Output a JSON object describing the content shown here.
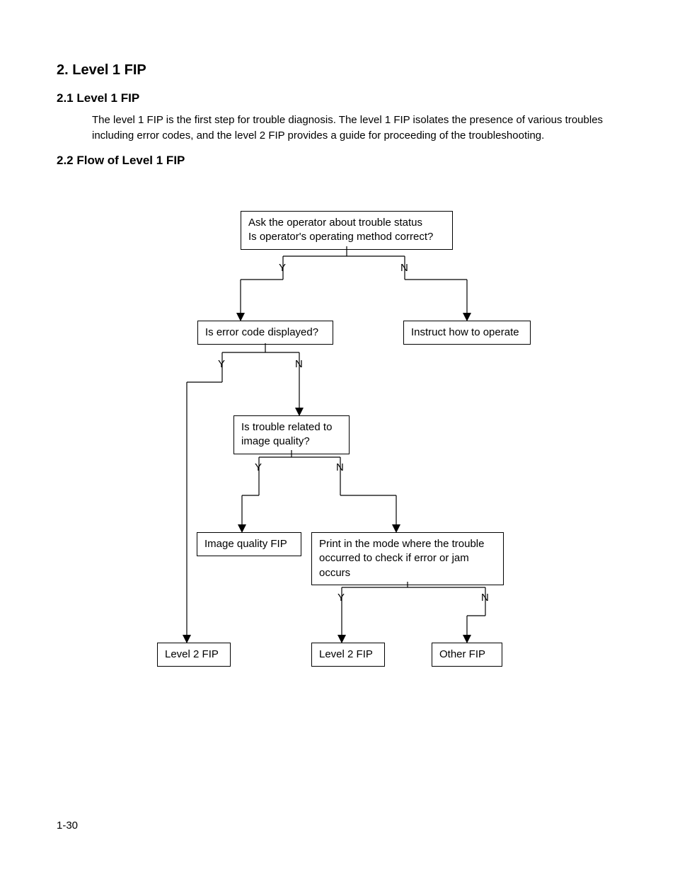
{
  "headings": {
    "main": "2.  Level 1 FIP",
    "s21": "2.1   Level 1 FIP",
    "s22": "2.2   Flow of Level 1 FIP"
  },
  "paragraphs": {
    "intro": "The level 1 FIP is the first step for trouble diagnosis. The level 1 FIP isolates the presence of various troubles including error codes, and the level 2 FIP provides a guide for proceeding of the troubleshooting."
  },
  "flow": {
    "b_ask": "Ask the operator about trouble status\nIs operator's operating method correct?",
    "b_err": "Is error code displayed?",
    "b_instruct": "Instruct how to operate",
    "b_quality": "Is trouble related to image quality?",
    "b_imagefip": "Image quality FIP",
    "b_print": "Print in the mode where the trouble occurred to check if error or jam occurs",
    "b_l2a": "Level 2 FIP",
    "b_l2b": "Level 2 FIP",
    "b_other": "Other FIP",
    "y": "Y",
    "n": "N"
  },
  "footer": {
    "page": "1-30"
  }
}
